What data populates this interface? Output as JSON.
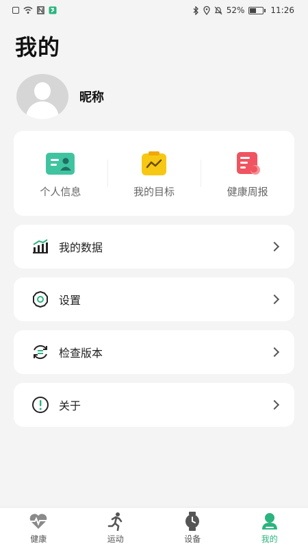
{
  "status_bar": {
    "battery": "52%",
    "time": "11:26"
  },
  "page": {
    "title": "我的"
  },
  "profile": {
    "nickname": "昵称"
  },
  "quick_actions": [
    {
      "label": "个人信息",
      "icon": "profile-card-icon",
      "color": "#40c4a0"
    },
    {
      "label": "我的目标",
      "icon": "goal-clipboard-icon",
      "color": "#f6c814"
    },
    {
      "label": "健康周报",
      "icon": "weekly-report-icon",
      "color": "#ef5460"
    }
  ],
  "menu": [
    {
      "label": "我的数据",
      "icon": "data-chart-icon"
    },
    {
      "label": "设置",
      "icon": "settings-icon"
    },
    {
      "label": "检查版本",
      "icon": "check-version-icon"
    },
    {
      "label": "关于",
      "icon": "about-icon"
    }
  ],
  "tabs": [
    {
      "label": "健康",
      "icon": "heart-pulse-icon"
    },
    {
      "label": "运动",
      "icon": "runner-icon"
    },
    {
      "label": "设备",
      "icon": "watch-icon"
    },
    {
      "label": "我的",
      "icon": "user-icon",
      "active": true
    }
  ],
  "colors": {
    "accent": "#2bb47e",
    "background": "#f4f4f4"
  }
}
